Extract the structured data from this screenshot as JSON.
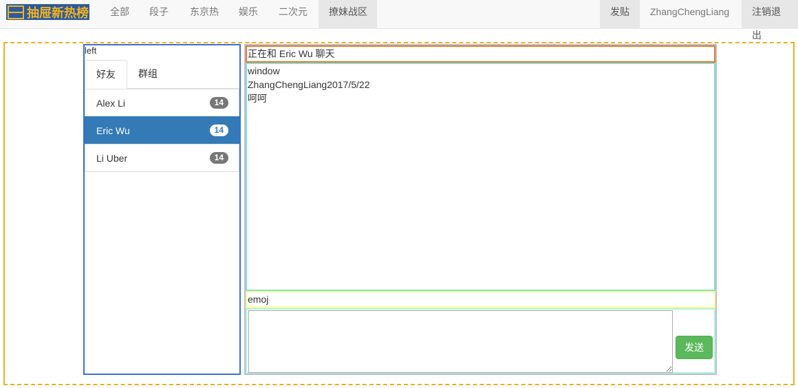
{
  "nav": {
    "brand": "抽屉新热榜",
    "items": [
      {
        "label": "全部"
      },
      {
        "label": "段子"
      },
      {
        "label": "东京热"
      },
      {
        "label": "娱乐"
      },
      {
        "label": "二次元"
      },
      {
        "label": "撩妹战区",
        "active": true
      }
    ],
    "right": {
      "post": "发贴",
      "user": "ZhangChengLiang",
      "logout": "注销退出"
    }
  },
  "left": {
    "label": "left",
    "tabs": [
      {
        "label": "好友",
        "active": true
      },
      {
        "label": "群组"
      }
    ],
    "friends": [
      {
        "name": "Alex Li",
        "count": "14"
      },
      {
        "name": "Eric Wu",
        "count": "14",
        "active": true
      },
      {
        "name": "Li Uber",
        "count": "14"
      }
    ]
  },
  "chat": {
    "header": "正在和 Eric Wu 聊天",
    "window_label": "window",
    "messages": [
      {
        "sender_time": "ZhangChengLiang2017/5/22",
        "text": "呵呵"
      }
    ],
    "emoji_label": "emoj",
    "input_value": "",
    "send_label": "发送"
  },
  "colors": {
    "brand_bg": "#2b5aa0",
    "brand_fg": "#f4b21a",
    "active_item": "#337ab7",
    "send": "#5cb85c"
  }
}
